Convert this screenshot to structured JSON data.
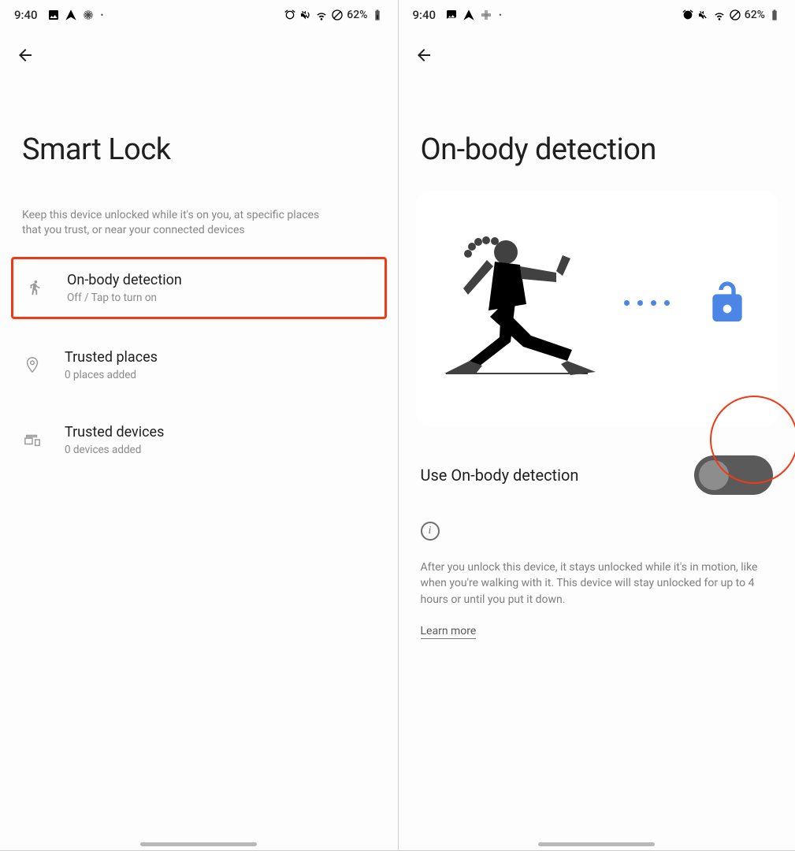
{
  "status": {
    "time": "9:40",
    "battery_text": "62%"
  },
  "screen1": {
    "title": "Smart Lock",
    "subtitle": "Keep this device unlocked while it's on you, at specific places that you trust, or near your connected devices",
    "items": [
      {
        "title": "On-body detection",
        "subtitle": "Off / Tap to turn on",
        "highlighted": true
      },
      {
        "title": "Trusted places",
        "subtitle": "0 places added"
      },
      {
        "title": "Trusted devices",
        "subtitle": "0 devices added"
      }
    ]
  },
  "screen2": {
    "title": "On-body detection",
    "toggle_label": "Use On-body detection",
    "toggle_on": false,
    "description": "After you unlock this device, it stays unlocked while it's in motion, like when you're walking with it. This device will stay unlocked for up to 4 hours or until you put it down.",
    "learn_more": "Learn more"
  },
  "colors": {
    "highlight": "#f13a15",
    "accent": "#4b85e6"
  }
}
